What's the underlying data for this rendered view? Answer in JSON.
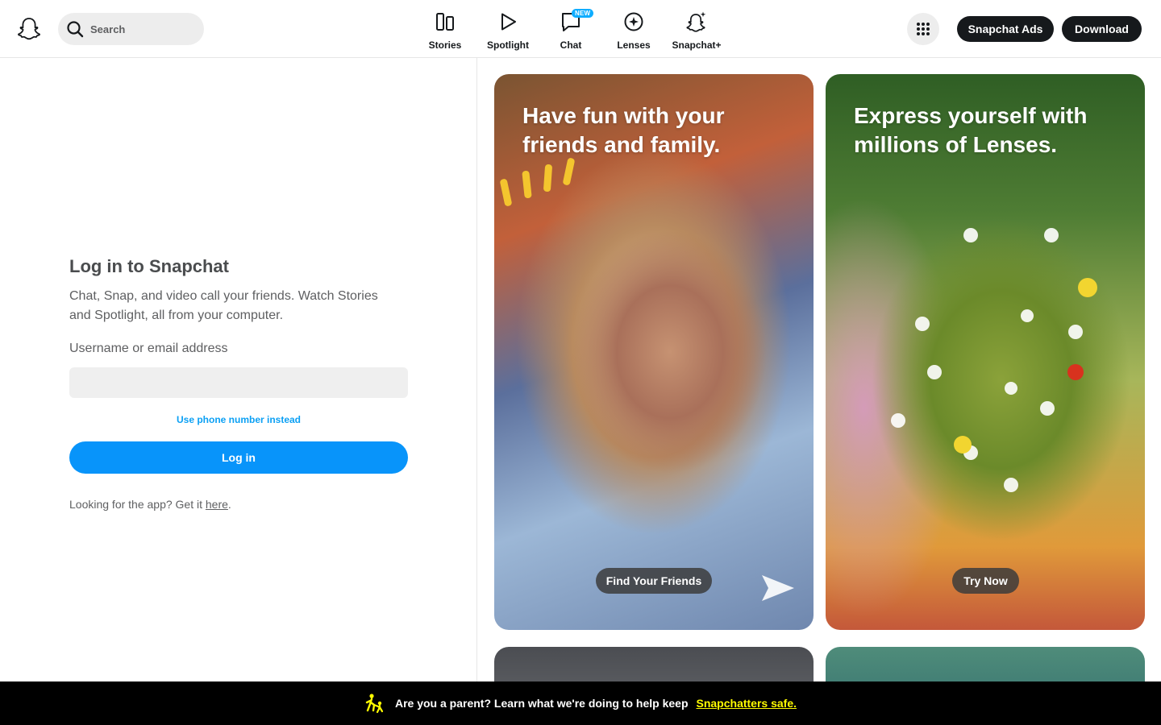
{
  "header": {
    "logo": "snapchat-ghost-icon",
    "search": {
      "placeholder": "Search",
      "value": ""
    },
    "nav": [
      {
        "label": "Stories",
        "icon": "stories-icon"
      },
      {
        "label": "Spotlight",
        "icon": "spotlight-play-icon"
      },
      {
        "label": "Chat",
        "icon": "chat-bubble-icon",
        "badge": "NEW"
      },
      {
        "label": "Lenses",
        "icon": "lenses-icon"
      },
      {
        "label": "Snapchat+",
        "icon": "snapchat-plus-icon"
      }
    ],
    "apps_icon": "apps-grid-icon",
    "ads_label": "Snapchat Ads",
    "download_label": "Download"
  },
  "login": {
    "title": "Log in to Snapchat",
    "subtitle": "Chat, Snap, and video call your friends. Watch Stories and Spotlight, all from your computer.",
    "username_label": "Username or email address",
    "username_value": "",
    "phone_link": "Use phone number instead",
    "login_button": "Log in",
    "app_prefix": "Looking for the app? Get it ",
    "app_link": "here",
    "app_suffix": "."
  },
  "cards": [
    {
      "title": "Have fun with your friends and family.",
      "cta": "Find Your Friends"
    },
    {
      "title": "Express yourself with millions of Lenses.",
      "cta": "Try Now"
    }
  ],
  "banner": {
    "icon": "parent-child-icon",
    "text": "Are you a parent? Learn what we're doing to help keep",
    "link": "Snapchatters safe."
  },
  "colors": {
    "primary_blue": "#0894fa",
    "link_blue": "#0ba0f4",
    "dark_button": "#16191c",
    "banner_link_yellow": "#fffc00",
    "new_badge": "#0fadff"
  }
}
